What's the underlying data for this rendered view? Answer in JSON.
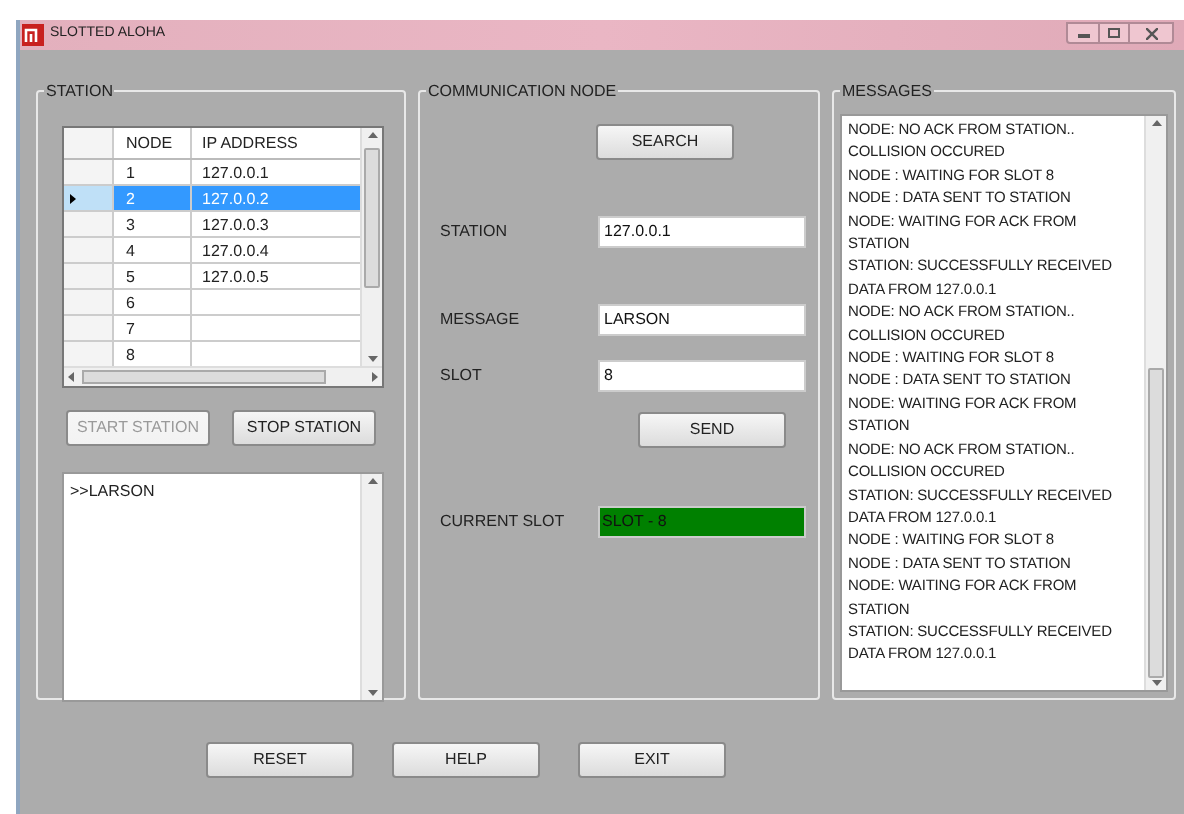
{
  "window": {
    "title": "SLOTTED ALOHA"
  },
  "station": {
    "title": "STATION",
    "table": {
      "columns": [
        "NODE",
        "IP ADDRESS"
      ],
      "rows": [
        {
          "node": "1",
          "ip": "127.0.0.1",
          "selected": false
        },
        {
          "node": "2",
          "ip": "127.0.0.2",
          "selected": true
        },
        {
          "node": "3",
          "ip": "127.0.0.3",
          "selected": false
        },
        {
          "node": "4",
          "ip": "127.0.0.4",
          "selected": false
        },
        {
          "node": "5",
          "ip": "127.0.0.5",
          "selected": false
        },
        {
          "node": "6",
          "ip": "",
          "selected": false
        },
        {
          "node": "7",
          "ip": "",
          "selected": false
        },
        {
          "node": "8",
          "ip": "",
          "selected": false
        }
      ]
    },
    "buttons": [
      {
        "label": "START STATION",
        "disabled": true
      },
      {
        "label": "STOP STATION",
        "disabled": false
      }
    ],
    "log": ">>LARSON"
  },
  "communication_node": {
    "title": "COMMUNICATION NODE",
    "search_button": "SEARCH",
    "fields": [
      {
        "label": "STATION",
        "value": "127.0.0.1"
      },
      {
        "label": "MESSAGE",
        "value": "LARSON"
      },
      {
        "label": "SLOT",
        "value": "8"
      }
    ],
    "send_button": "SEND",
    "current_slot": {
      "label": "CURRENT SLOT",
      "value": "SLOT - 8"
    }
  },
  "messages": {
    "title": "MESSAGES",
    "lines": [
      "NODE: NO ACK FROM STATION..",
      "COLLISION OCCURED",
      "NODE : WAITING FOR SLOT 8",
      "NODE : DATA SENT TO STATION",
      "NODE: WAITING FOR ACK FROM",
      "STATION",
      "STATION: SUCCESSFULLY RECEIVED",
      "DATA FROM 127.0.0.1",
      "NODE: NO ACK FROM STATION..",
      "COLLISION OCCURED",
      "NODE : WAITING FOR SLOT 8",
      "NODE : DATA SENT TO STATION",
      "NODE: WAITING FOR ACK FROM",
      "STATION",
      "NODE: NO ACK FROM STATION..",
      "COLLISION OCCURED",
      "STATION: SUCCESSFULLY RECEIVED",
      "DATA FROM 127.0.0.1",
      "NODE : WAITING FOR SLOT 8",
      "NODE : DATA SENT TO STATION",
      "NODE: WAITING FOR ACK FROM",
      "STATION",
      "STATION: SUCCESSFULLY RECEIVED",
      "DATA FROM 127.0.0.1"
    ]
  },
  "buttons": [
    "RESET",
    "HELP",
    "EXIT"
  ]
}
